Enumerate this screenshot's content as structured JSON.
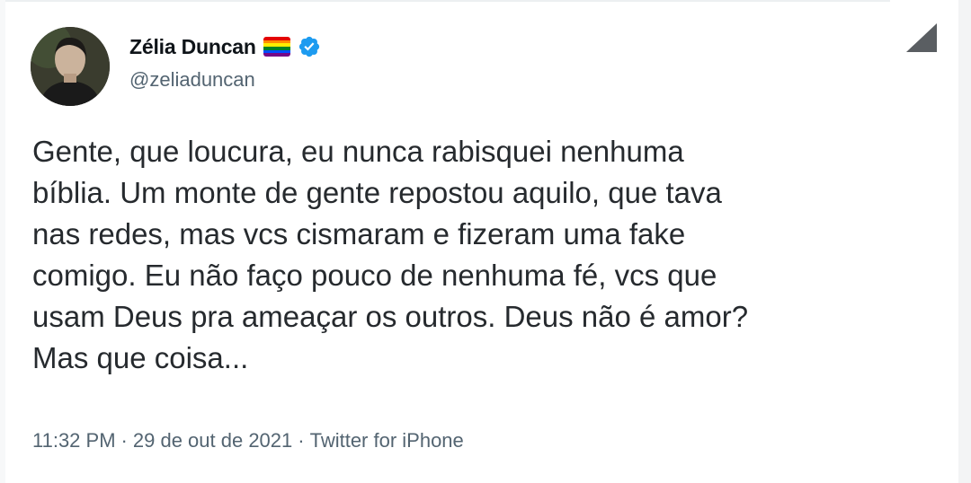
{
  "tweet": {
    "author": {
      "display_name": "Zélia Duncan",
      "handle": "@zeliaduncan",
      "badges": [
        "rainbow-flag-icon",
        "verified-icon"
      ]
    },
    "text_lines": [
      "Gente, que loucura, eu nunca rabisquei nenhuma",
      "bíblia. Um monte de gente repostou aquilo, que tava",
      "nas redes, mas vcs cismaram e fizeram uma fake",
      "comigo. Eu não faço pouco de nenhuma fé, vcs que",
      "usam Deus pra ameaçar os outros. Deus não é amor?",
      "Mas que coisa..."
    ],
    "meta": {
      "time": "11:32 PM",
      "date": "29 de out de 2021",
      "source": "Twitter for iPhone",
      "separator": "·"
    }
  },
  "colors": {
    "text_primary": "#0f1419",
    "text_secondary": "#536471",
    "verified": "#1d9bf0",
    "flag": [
      "#e40303",
      "#ff8c00",
      "#ffed00",
      "#008026",
      "#004dff",
      "#750787"
    ]
  }
}
